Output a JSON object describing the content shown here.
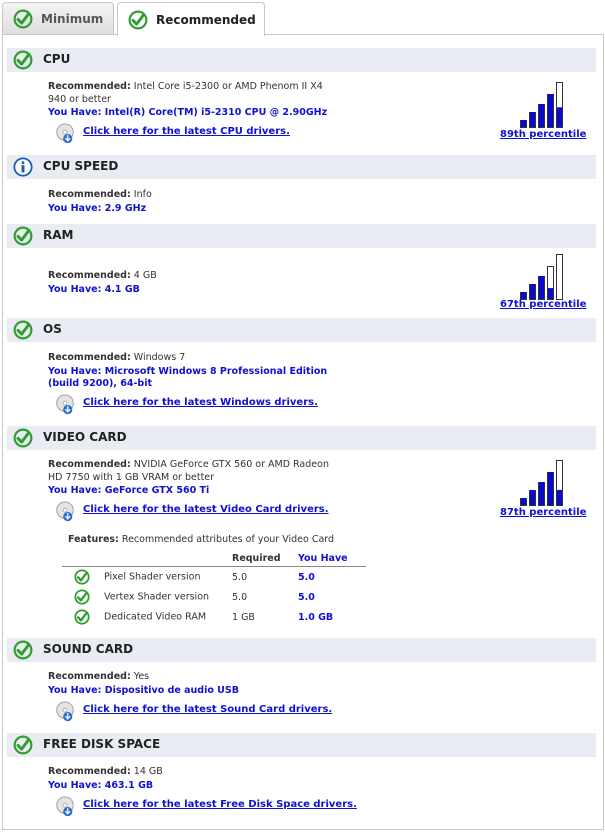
{
  "tabs": [
    {
      "label": "Minimum"
    },
    {
      "label": "Recommended"
    }
  ],
  "colors": {
    "accent_green": "#2e9e2e",
    "link_blue": "#1010d0",
    "info_blue": "#1a5fb4",
    "header_bg": "#e9ecf2"
  },
  "sections": {
    "cpu": {
      "title": "CPU",
      "rec_label": "Recommended:",
      "rec_value_1": "Intel Core i5-2300 or AMD Phenom II X4",
      "rec_value_2": "940 or better",
      "have": "You Have: Intel(R) Core(TM) i5-2310 CPU @ 2.90GHz",
      "link": "Click here for the latest CPU drivers.",
      "percentile_label": "89th percentile",
      "percentile": 89
    },
    "cpu_speed": {
      "title": "CPU SPEED",
      "rec_label": "Recommended:",
      "rec_value": "Info",
      "have": "You Have: 2.9 GHz"
    },
    "ram": {
      "title": "RAM",
      "rec_label": "Recommended:",
      "rec_value": "4 GB",
      "have": "You Have: 4.1 GB",
      "percentile_label": "67th percentile",
      "percentile": 67
    },
    "os": {
      "title": "OS",
      "rec_label": "Recommended:",
      "rec_value": "Windows 7",
      "have_1": "You Have: Microsoft Windows 8 Professional Edition",
      "have_2": "(build 9200), 64-bit",
      "link": "Click here for the latest Windows drivers."
    },
    "video": {
      "title": "VIDEO CARD",
      "rec_label": "Recommended:",
      "rec_value_1": "NVIDIA GeForce GTX 560 or AMD Radeon",
      "rec_value_2": "HD 7750 with 1 GB VRAM or better",
      "have": "You Have: GeForce GTX 560 Ti",
      "link": "Click here for the latest Video Card drivers.",
      "percentile_label": "87th percentile",
      "percentile": 87,
      "features_label": "Features:",
      "features_desc": "Recommended attributes of your Video Card",
      "col_required": "Required",
      "col_have": "You Have",
      "features": [
        {
          "name": "Pixel Shader version",
          "required": "5.0",
          "have": "5.0"
        },
        {
          "name": "Vertex Shader version",
          "required": "5.0",
          "have": "5.0"
        },
        {
          "name": "Dedicated Video RAM",
          "required": "1 GB",
          "have": "1.0 GB"
        }
      ]
    },
    "sound": {
      "title": "SOUND CARD",
      "rec_label": "Recommended:",
      "rec_value": "Yes",
      "have": "You Have: Dispositivo de audio USB",
      "link": "Click here for the latest Sound Card drivers."
    },
    "disk": {
      "title": "FREE DISK SPACE",
      "rec_label": "Recommended:",
      "rec_value": "14 GB",
      "have": "You Have: 463.1 GB",
      "link": "Click here for the latest Free Disk Space drivers."
    }
  }
}
